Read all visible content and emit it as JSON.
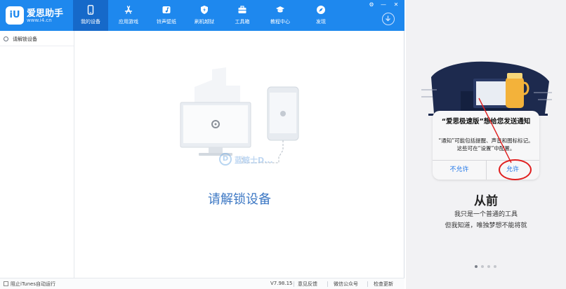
{
  "app": {
    "logo_mark": "iU",
    "logo_name": "爱思助手",
    "logo_url": "www.i4.cn",
    "nav": [
      {
        "label": "我的设备",
        "icon": "phone-icon",
        "active": true
      },
      {
        "label": "应用游戏",
        "icon": "app-store-icon",
        "active": false
      },
      {
        "label": "铃声壁纸",
        "icon": "ringtone-icon",
        "active": false
      },
      {
        "label": "刷机越狱",
        "icon": "flash-icon",
        "active": false
      },
      {
        "label": "工具箱",
        "icon": "toolbox-icon",
        "active": false
      },
      {
        "label": "教程中心",
        "icon": "graduation-cap-icon",
        "active": false
      },
      {
        "label": "发现",
        "icon": "compass-icon",
        "active": false
      }
    ],
    "window_controls": {
      "settings": "⚙",
      "minimize": "—",
      "close": "✕"
    },
    "sidebar": {
      "device_label": "请解锁设备"
    },
    "main": {
      "title": "请解锁设备"
    },
    "watermark": {
      "mark": "D",
      "text": "蓝鲸士D..."
    },
    "statusbar": {
      "itunes_label": "阻止iTunes自动运行",
      "version": "V7.98.15",
      "feedback": "意见反馈",
      "wechat": "微信公众号",
      "update": "检查更新"
    }
  },
  "phone": {
    "alert": {
      "title": "“爱思极速版”想给您发送通知",
      "message": "“通知”可能包括提醒、声音和图标标记。这些可在“设置”中配置。",
      "deny": "不允许",
      "allow": "允许"
    },
    "heading": "从前",
    "line1": "我只是一个普通的工具",
    "line2": "但我知道，唯独梦想不能将就",
    "page_count": 4,
    "current_page": 1
  },
  "colors": {
    "topbar": "#1e88ee",
    "active_nav": "#1669c9",
    "title_blue": "#3d78c4",
    "alert_button": "#1a73e8",
    "annotation_red": "#e02020"
  }
}
